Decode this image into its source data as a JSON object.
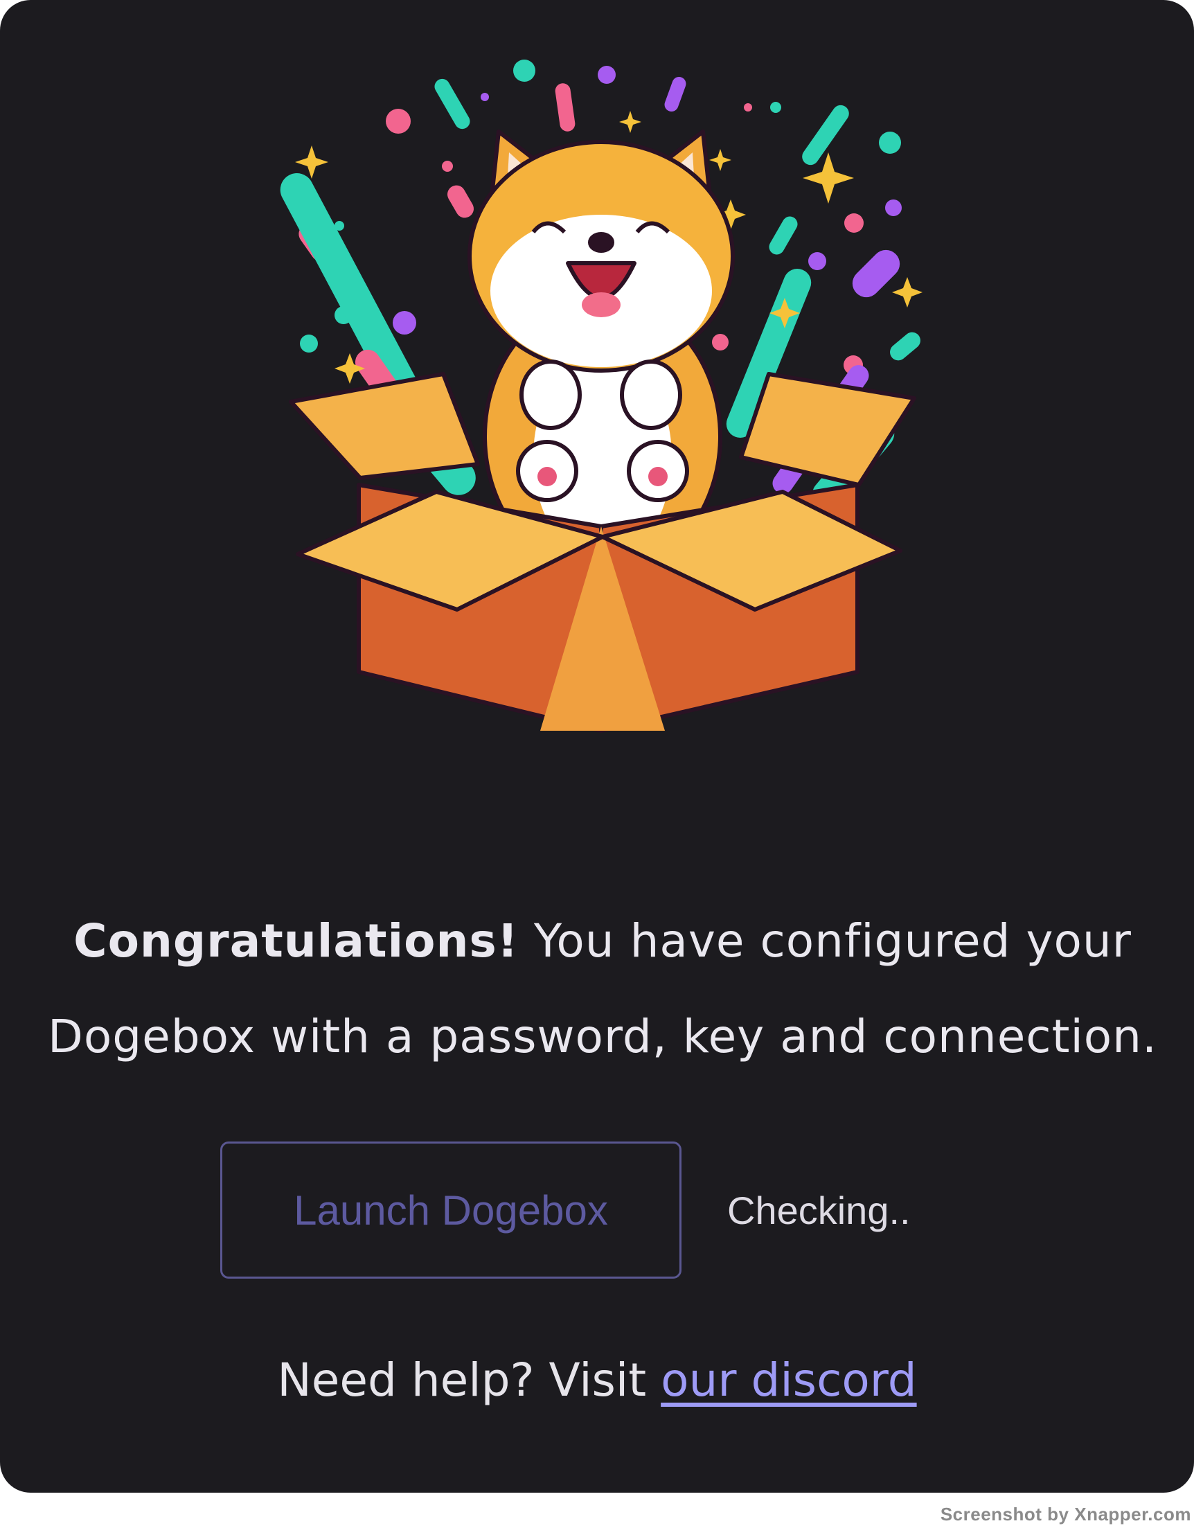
{
  "message": {
    "bold_text": "Congratulations!",
    "text": " You have configured your Dogebox with a password, key and connection."
  },
  "actions": {
    "launch_label": "Launch Dogebox",
    "status": "Checking.."
  },
  "help": {
    "prefix": "Need help? Visit ",
    "link_label": "our discord"
  },
  "watermark": "Screenshot by Xnapper.com",
  "colors": {
    "background": "#1c1b1f",
    "text": "#eae8ef",
    "button_border": "#5a5791",
    "button_text": "#5d5aa0",
    "link": "#9e9bf6"
  },
  "illustration": {
    "subject": "shiba-inu-dog-in-open-box-with-confetti"
  }
}
